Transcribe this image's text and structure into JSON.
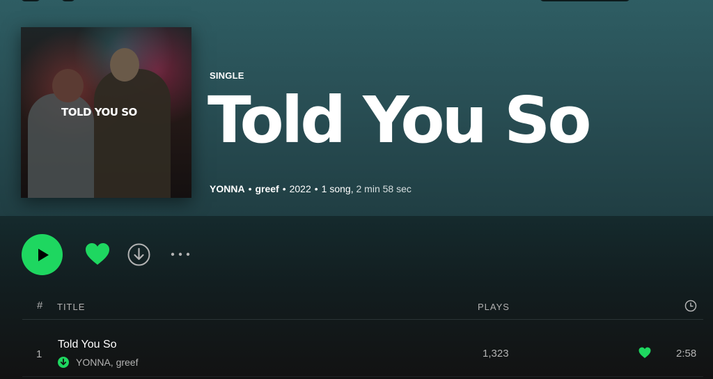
{
  "album": {
    "type": "SINGLE",
    "title": "Told You So",
    "cover_text": "TOLD YOU SO",
    "artist1": "YONNA",
    "artist2": "greef",
    "year": "2022",
    "song_count": "1 song,",
    "duration": "2 min 58 sec"
  },
  "controls": {
    "play_icon": "play-icon",
    "like_icon": "heart-icon",
    "download_icon": "download-icon",
    "more_icon": "more-icon"
  },
  "tracklist": {
    "header": {
      "number": "#",
      "title": "TITLE",
      "plays": "PLAYS",
      "duration_icon": "clock-icon"
    },
    "tracks": [
      {
        "number": "1",
        "title": "Told You So",
        "artists": "YONNA, greef",
        "plays": "1,323",
        "duration": "2:58",
        "downloaded": true,
        "liked": true
      }
    ]
  },
  "colors": {
    "accent": "#1ed760",
    "header_bg": "#2e5d63",
    "background": "#121212"
  }
}
